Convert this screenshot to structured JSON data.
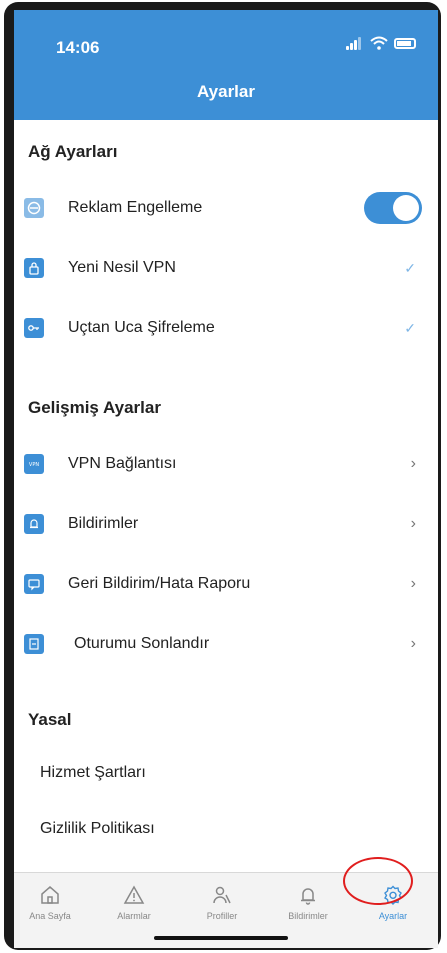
{
  "status": {
    "time": "14:06"
  },
  "header": {
    "title": "Ayarlar"
  },
  "sections": {
    "network": {
      "title": "Ağ Ayarları",
      "items": [
        {
          "label": "Reklam Engelleme",
          "icon": "block-icon",
          "control": "toggle",
          "on": true
        },
        {
          "label": "Yeni Nesil VPN",
          "icon": "lock-icon",
          "control": "check"
        },
        {
          "label": "Uçtan Uca Şifreleme",
          "icon": "key-icon",
          "control": "check"
        }
      ]
    },
    "advanced": {
      "title": "Gelişmiş Ayarlar",
      "items": [
        {
          "label": "VPN Bağlantısı",
          "icon": "vpn-icon"
        },
        {
          "label": "Bildirimler",
          "icon": "bell-icon"
        },
        {
          "label": "Geri Bildirim/Hata Raporu",
          "icon": "feedback-icon"
        },
        {
          "label": "Oturumu Sonlandır",
          "icon": "logout-icon"
        }
      ]
    },
    "legal": {
      "title": "Yasal",
      "items": [
        {
          "label": "Hizmet Şartları"
        },
        {
          "label": "Gizlilik Politikası"
        }
      ]
    }
  },
  "tabbar": {
    "items": [
      {
        "label": "Ana Sayfa",
        "icon": "home-icon"
      },
      {
        "label": "Alarmlar",
        "icon": "warning-icon"
      },
      {
        "label": "Profiller",
        "icon": "profiles-icon"
      },
      {
        "label": "Bildirimler",
        "icon": "bell-icon"
      },
      {
        "label": "Ayarlar",
        "icon": "gear-icon",
        "active": true
      }
    ]
  },
  "colors": {
    "accent": "#3d8fd6",
    "highlight": "#e01e1e"
  }
}
